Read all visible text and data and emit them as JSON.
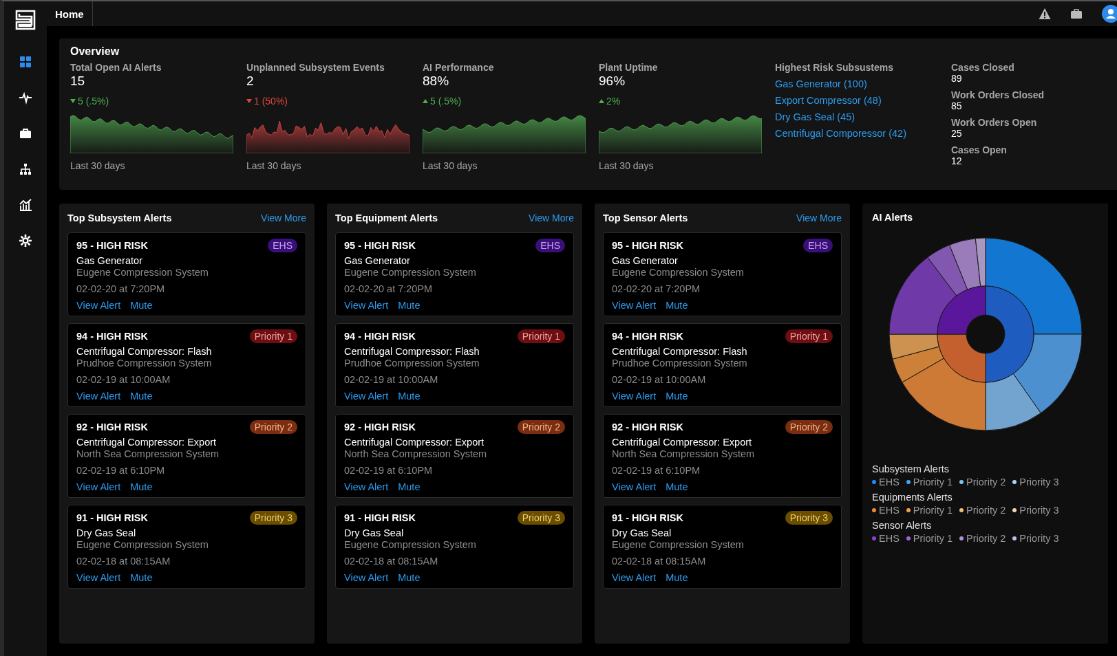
{
  "header": {
    "tab": "Home"
  },
  "nav": [
    {
      "selected": true
    },
    {
      "selected": false
    },
    {
      "selected": false
    },
    {
      "selected": false
    },
    {
      "selected": false
    },
    {
      "selected": false
    }
  ],
  "overview": {
    "title": "Overview",
    "metrics": [
      {
        "label": "Total Open AI Alerts",
        "value": "15",
        "change": "5 (.5%)",
        "rising": false,
        "favorable": true,
        "period": "Last 30 days"
      },
      {
        "label": "Unplanned Subsystem Events",
        "value": "2",
        "change": "1 (50%)",
        "rising": false,
        "favorable": false,
        "period": "Last 30 days"
      },
      {
        "label": "AI Performance",
        "value": "88%",
        "change": "5 (.5%)",
        "rising": true,
        "favorable": true,
        "period": "Last 30 days"
      },
      {
        "label": "Plant Uptime",
        "value": "96%",
        "change": "2%",
        "rising": true,
        "favorable": true,
        "period": "Last 30 days"
      }
    ],
    "risk": {
      "title": "Highest Risk Subsustems",
      "links": [
        "Gas Generator (100)",
        "Export Compressor (48)",
        "Dry Gas Seal (45)",
        "Centrifugal Comporessor (42)"
      ]
    },
    "counts": [
      {
        "label": "Cases Closed",
        "value": "89"
      },
      {
        "label": "Work Orders Closed",
        "value": "85"
      },
      {
        "label": "Work Orders Open",
        "value": "25"
      },
      {
        "label": "Cases Open",
        "value": "12"
      }
    ]
  },
  "panels": [
    {
      "title": "Top Subsystem Alerts",
      "view_more": "View More",
      "alerts": [
        {
          "score": "95 - HIGH RISK",
          "title": "Gas Generator",
          "system": "Eugene Compression System",
          "time": "02-02-20 at 7:20PM",
          "badge": {
            "label": "EHS",
            "kind": "ehs"
          },
          "actions": [
            "View Alert",
            "Mute"
          ]
        },
        {
          "score": "94 - HIGH RISK",
          "title": "Centrifugal Compressor: Flash",
          "system": "Prudhoe Compression System",
          "time": "02-02-19 at 10:00AM",
          "badge": {
            "label": "Priority 1",
            "kind": "p1"
          },
          "actions": [
            "View Alert",
            "Mute"
          ]
        },
        {
          "score": "92 - HIGH RISK",
          "title": "Centrifugal Compressor: Export",
          "system": "North Sea Compression System",
          "time": "02-02-19 at 6:10PM",
          "badge": {
            "label": "Priority 2",
            "kind": "p2"
          },
          "actions": [
            "View Alert",
            "Mute"
          ]
        },
        {
          "score": "91 - HIGH RISK",
          "title": "Dry Gas Seal",
          "system": "Eugene Compression System",
          "time": "02-02-18 at 08:15AM",
          "badge": {
            "label": "Priority 3",
            "kind": "p3"
          },
          "actions": [
            "View Alert",
            "Mute"
          ]
        }
      ]
    },
    {
      "title": "Top Equipment Alerts",
      "view_more": "View More",
      "alerts": [
        {
          "score": "95 - HIGH RISK",
          "title": "Gas Generator",
          "system": "Eugene Compression System",
          "time": "02-02-20 at 7:20PM",
          "badge": {
            "label": "EHS",
            "kind": "ehs"
          },
          "actions": [
            "View Alert",
            "Mute"
          ]
        },
        {
          "score": "94 - HIGH RISK",
          "title": "Centrifugal Compressor: Flash",
          "system": "Prudhoe Compression System",
          "time": "02-02-19 at 10:00AM",
          "badge": {
            "label": "Priority 1",
            "kind": "p1"
          },
          "actions": [
            "View Alert",
            "Mute"
          ]
        },
        {
          "score": "92 - HIGH RISK",
          "title": "Centrifugal Compressor: Export",
          "system": "North Sea Compression System",
          "time": "02-02-19 at 6:10PM",
          "badge": {
            "label": "Priority 2",
            "kind": "p2"
          },
          "actions": [
            "View Alert",
            "Mute"
          ]
        },
        {
          "score": "91 - HIGH RISK",
          "title": "Dry Gas Seal",
          "system": "Eugene Compression System",
          "time": "02-02-18 at 08:15AM",
          "badge": {
            "label": "Priority 3",
            "kind": "p3"
          },
          "actions": [
            "View Alert",
            "Mute"
          ]
        }
      ]
    },
    {
      "title": "Top Sensor Alerts",
      "view_more": "View More",
      "alerts": [
        {
          "score": "95 - HIGH RISK",
          "title": "Gas Generator",
          "system": "Eugene Compression System",
          "time": "02-02-20 at 7:20PM",
          "badge": {
            "label": "EHS",
            "kind": "ehs"
          },
          "actions": [
            "View Alert",
            "Mute"
          ]
        },
        {
          "score": "94 - HIGH RISK",
          "title": "Centrifugal Compressor: Flash",
          "system": "Prudhoe Compression System",
          "time": "02-02-19 at 10:00AM",
          "badge": {
            "label": "Priority 1",
            "kind": "p1"
          },
          "actions": [
            "View Alert",
            "Mute"
          ]
        },
        {
          "score": "92 - HIGH RISK",
          "title": "Centrifugal Compressor: Export",
          "system": "North Sea Compression System",
          "time": "02-02-19 at 6:10PM",
          "badge": {
            "label": "Priority 2",
            "kind": "p2"
          },
          "actions": [
            "View Alert",
            "Mute"
          ]
        },
        {
          "score": "91 - HIGH RISK",
          "title": "Dry Gas Seal",
          "system": "Eugene Compression System",
          "time": "02-02-18 at 08:15AM",
          "badge": {
            "label": "Priority 3",
            "kind": "p3"
          },
          "actions": [
            "View Alert",
            "Mute"
          ]
        }
      ]
    }
  ],
  "ai_alerts": {
    "title": "AI Alerts",
    "legend": [
      {
        "title": "Subsystem Alerts",
        "items": [
          {
            "label": "EHS",
            "color": "#1a8cff"
          },
          {
            "label": "Priority 1",
            "color": "#3fa9f5"
          },
          {
            "label": "Priority 2",
            "color": "#7cc4f7"
          },
          {
            "label": "Priority 3",
            "color": "#a9d7f7"
          }
        ]
      },
      {
        "title": "Equipments Alerts",
        "items": [
          {
            "label": "EHS",
            "color": "#f08a30"
          },
          {
            "label": "Priority 1",
            "color": "#f4a04a"
          },
          {
            "label": "Priority 2",
            "color": "#f6bb7a"
          },
          {
            "label": "Priority 3",
            "color": "#f8d3a8"
          }
        ]
      },
      {
        "title": "Sensor Alerts",
        "items": [
          {
            "label": "EHS",
            "color": "#8e3fd6"
          },
          {
            "label": "Priority 1",
            "color": "#a066d9"
          },
          {
            "label": "Priority 2",
            "color": "#b68fe0"
          },
          {
            "label": "Priority 3",
            "color": "#cdb6ea"
          }
        ]
      }
    ]
  }
}
